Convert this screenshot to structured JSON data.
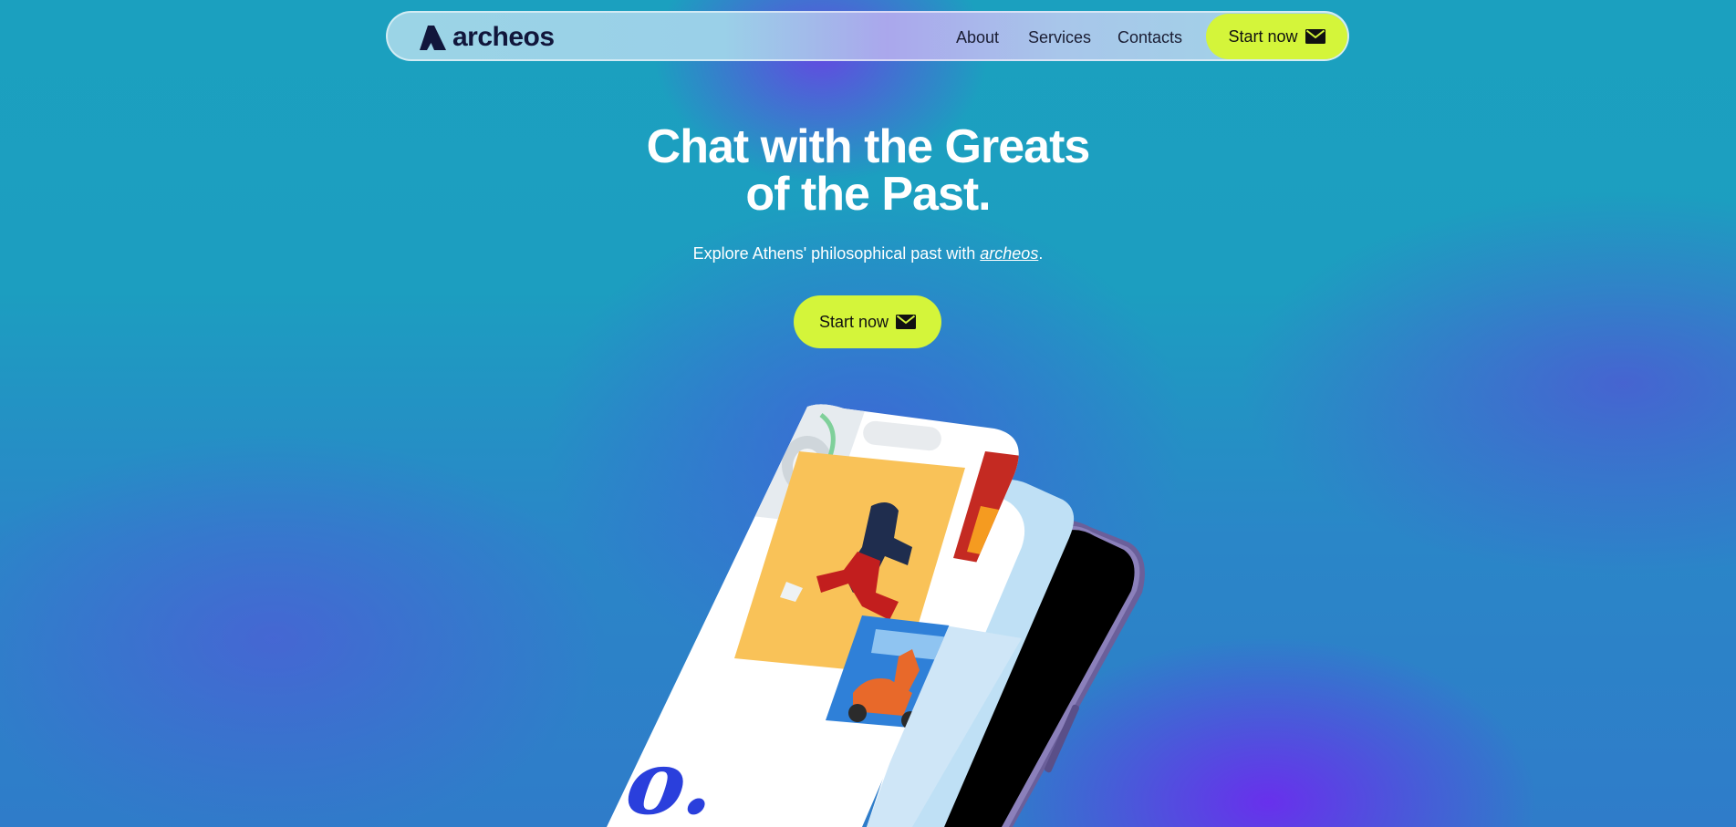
{
  "nav": {
    "logo_text": "archeos",
    "links": [
      "About",
      "Services",
      "Contacts"
    ],
    "cta_label": "Start now",
    "cta_icon": "mail-icon"
  },
  "hero": {
    "title_line1": "Chat with the Greats",
    "title_line2": "of the Past.",
    "subtitle_prefix": "Explore Athens' philosophical past with ",
    "subtitle_brand": "archeos",
    "subtitle_suffix": ".",
    "cta_label": "Start now",
    "cta_icon": "mail-icon"
  },
  "phone": {
    "screen_logo_text": "co."
  },
  "colors": {
    "accent": "#d4f53a",
    "logo": "#11163b",
    "brand_blue": "#2a3fdc"
  }
}
